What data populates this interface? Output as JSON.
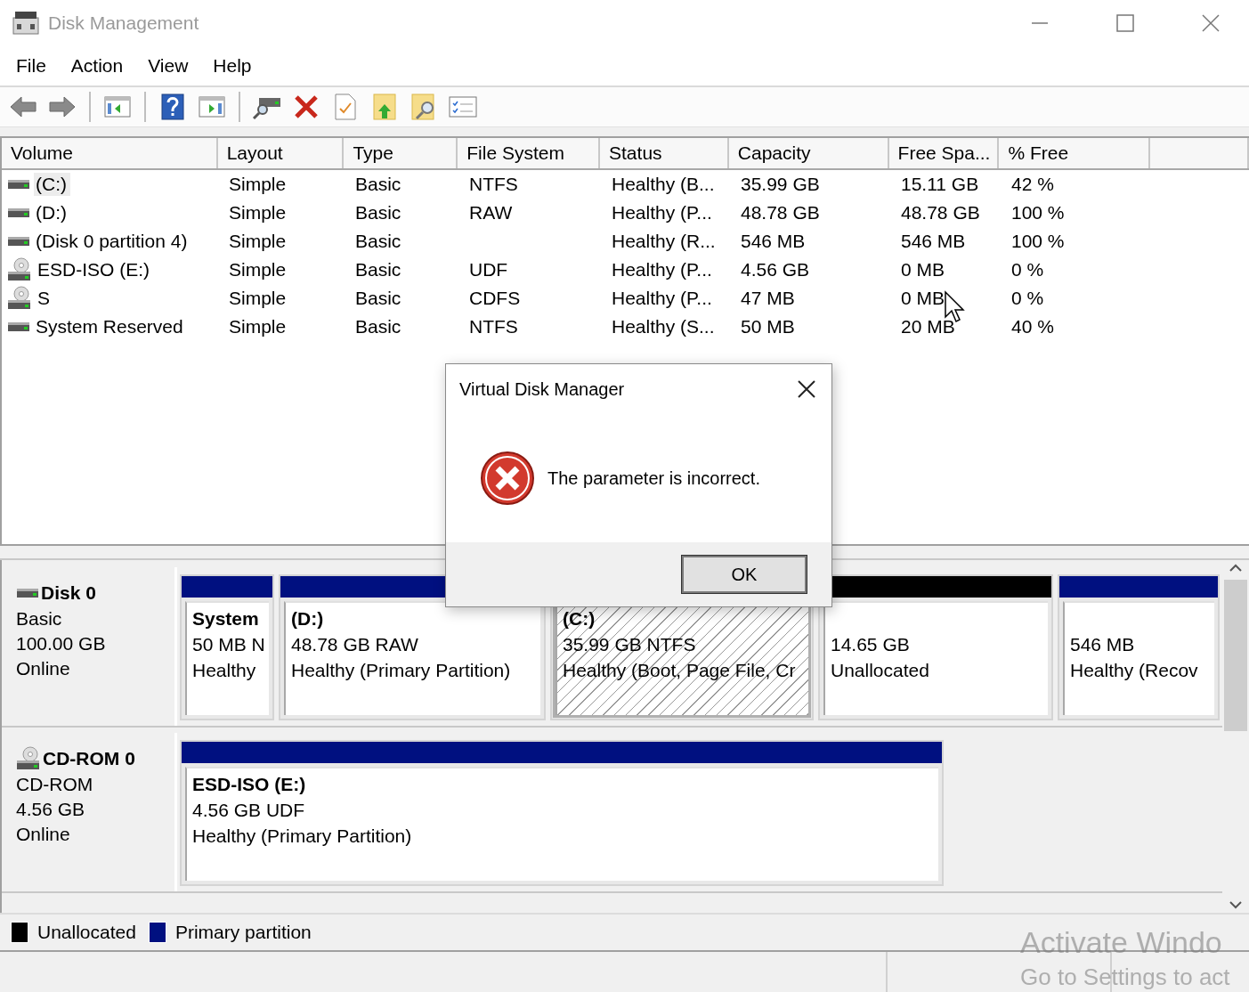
{
  "window": {
    "title": "Disk Management"
  },
  "menu": [
    "File",
    "Action",
    "View",
    "Help"
  ],
  "table": {
    "columns": [
      "Volume",
      "Layout",
      "Type",
      "File System",
      "Status",
      "Capacity",
      "Free Spa...",
      "% Free"
    ],
    "rows": [
      {
        "kind": "disk",
        "selected": true,
        "cells": [
          "(C:)",
          "Simple",
          "Basic",
          "NTFS",
          "Healthy (B...",
          "35.99 GB",
          "15.11 GB",
          "42 %"
        ]
      },
      {
        "kind": "disk",
        "selected": false,
        "cells": [
          "(D:)",
          "Simple",
          "Basic",
          "RAW",
          "Healthy (P...",
          "48.78 GB",
          "48.78 GB",
          "100 %"
        ]
      },
      {
        "kind": "disk",
        "selected": false,
        "cells": [
          "(Disk 0 partition 4)",
          "Simple",
          "Basic",
          "",
          "Healthy (R...",
          "546 MB",
          "546 MB",
          "100 %"
        ]
      },
      {
        "kind": "cdrom",
        "selected": false,
        "cells": [
          "ESD-ISO (E:)",
          "Simple",
          "Basic",
          "UDF",
          "Healthy (P...",
          "4.56 GB",
          "0 MB",
          "0 %"
        ]
      },
      {
        "kind": "cdrom",
        "selected": false,
        "cells": [
          "S",
          "Simple",
          "Basic",
          "CDFS",
          "Healthy (P...",
          "47 MB",
          "0 MB",
          "0 %"
        ]
      },
      {
        "kind": "disk",
        "selected": false,
        "cells": [
          "System Reserved",
          "Simple",
          "Basic",
          "NTFS",
          "Healthy (S...",
          "50 MB",
          "20 MB",
          "40 %"
        ]
      }
    ]
  },
  "disks": [
    {
      "kind": "disk",
      "name": "Disk 0",
      "type": "Basic",
      "size": "100.00 GB",
      "status": "Online",
      "partitions": [
        {
          "label": "System",
          "detail": "50 MB N",
          "status": "Healthy",
          "color": "#001080",
          "selected": false
        },
        {
          "label": "(D:)",
          "detail": "48.78 GB RAW",
          "status": "Healthy (Primary Partition)",
          "color": "#001080",
          "selected": false
        },
        {
          "label": "(C:)",
          "detail": "35.99 GB NTFS",
          "status": "Healthy (Boot, Page File, Cr",
          "selected": true
        },
        {
          "detail": "14.65 GB",
          "status": "Unallocated",
          "color": "#000000",
          "selected": false
        },
        {
          "detail": "546 MB",
          "status": "Healthy (Recov",
          "color": "#001080",
          "selected": false
        }
      ]
    },
    {
      "kind": "cdrom",
      "name": "CD-ROM 0",
      "type": "CD-ROM",
      "size": "4.56 GB",
      "status": "Online",
      "partitions": [
        {
          "label": "ESD-ISO  (E:)",
          "detail": "4.56 GB UDF",
          "status": "Healthy (Primary Partition)",
          "color": "#001080",
          "selected": false
        }
      ]
    }
  ],
  "legend": [
    {
      "label": "Unallocated",
      "color": "#000000"
    },
    {
      "label": "Primary partition",
      "color": "#001080"
    }
  ],
  "dialog": {
    "title": "Virtual Disk Manager",
    "message": "The parameter is incorrect.",
    "button": "OK"
  },
  "activation_notice": [
    "Activate Windo",
    "Go to Settings to act"
  ]
}
